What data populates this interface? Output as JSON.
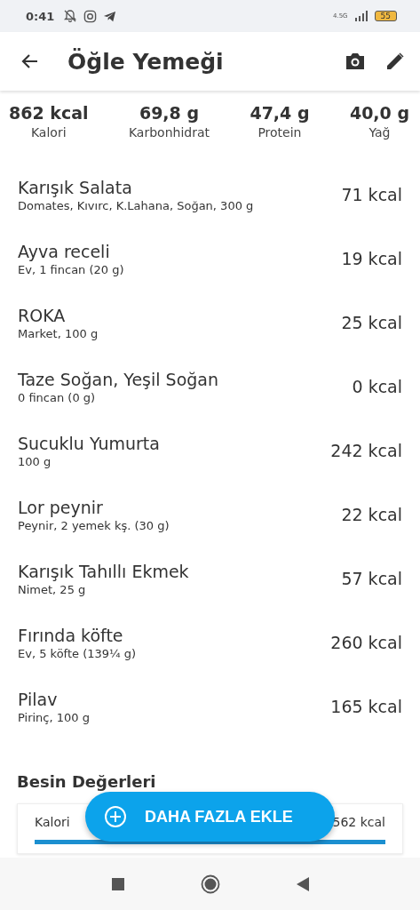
{
  "status_bar": {
    "time": "0:41",
    "network": "4.5G",
    "battery": "55"
  },
  "header": {
    "title": "Öğle Yemeği"
  },
  "summary": [
    {
      "value": "862 kcal",
      "label": "Kalori"
    },
    {
      "value": "69,8 g",
      "label": "Karbonhidrat"
    },
    {
      "value": "47,4 g",
      "label": "Protein"
    },
    {
      "value": "40,0 g",
      "label": "Yağ"
    }
  ],
  "foods": [
    {
      "name": "Karışık Salata",
      "detail": "Domates, Kıvırc, K.Lahana, Soğan, 300 g",
      "calories": "71 kcal"
    },
    {
      "name": "Ayva receli",
      "detail": "Ev, 1 fincan (20 g)",
      "calories": "19 kcal"
    },
    {
      "name": "ROKA",
      "detail": "Market, 100 g",
      "calories": "25 kcal"
    },
    {
      "name": "Taze Soğan, Yeşil Soğan",
      "detail": "0 fincan (0 g)",
      "calories": "0 kcal"
    },
    {
      "name": "Sucuklu Yumurta",
      "detail": "100 g",
      "calories": "242 kcal"
    },
    {
      "name": "Lor peynir",
      "detail": "Peynir, 2 yemek kş. (30 g)",
      "calories": "22 kcal"
    },
    {
      "name": "Karışık Tahıllı Ekmek",
      "detail": "Nimet, 25 g",
      "calories": "57 kcal"
    },
    {
      "name": "Fırında köfte",
      "detail": "Ev, 5 köfte (139¼ g)",
      "calories": "260 kcal"
    },
    {
      "name": "Pilav",
      "detail": "Pirinç, 100 g",
      "calories": "165 kcal"
    }
  ],
  "nutrition": {
    "title": "Besin Değerleri",
    "rows": [
      {
        "label": "Kalori",
        "reading": "562 kcal",
        "level": 1
      }
    ]
  },
  "fab": {
    "label": "DAHA FAZLA EKLE"
  }
}
